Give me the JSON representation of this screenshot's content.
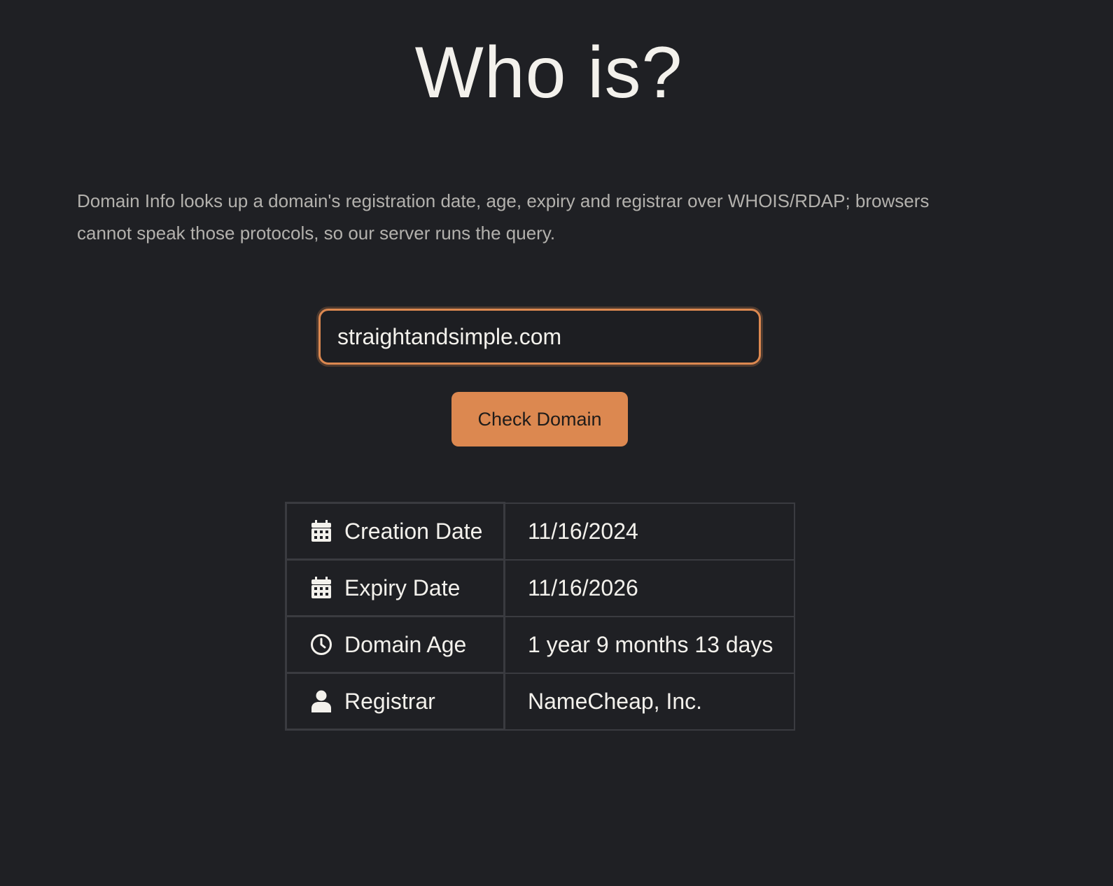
{
  "page": {
    "title": "Who is?",
    "description": "Domain Info looks up a domain's registration date, age, expiry and registrar over WHOIS/RDAP; browsers cannot speak those protocols, so our server runs the query."
  },
  "search": {
    "value": "straightandsimple.com",
    "button_label": "Check Domain"
  },
  "results": {
    "rows": [
      {
        "icon": "calendar-icon",
        "label": "Creation Date",
        "value": "11/16/2024"
      },
      {
        "icon": "calendar-icon",
        "label": "Expiry Date",
        "value": "11/16/2026"
      },
      {
        "icon": "clock-icon",
        "label": "Domain Age",
        "value": "1 year 9 months 13 days"
      },
      {
        "icon": "user-icon",
        "label": "Registrar",
        "value": "NameCheap, Inc."
      }
    ]
  },
  "colors": {
    "background": "#1f2024",
    "accent": "#dc8850",
    "text": "#f3f1ec",
    "muted_text": "#b3b1ad",
    "border": "#3a3b40"
  }
}
